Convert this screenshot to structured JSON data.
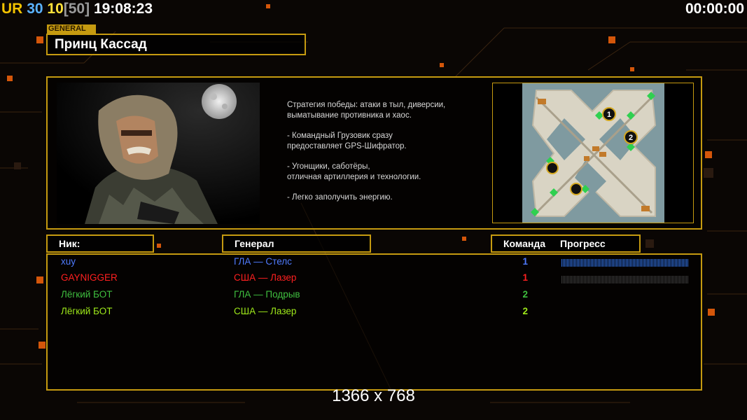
{
  "hud": {
    "ur": "UR",
    "val_a": "30",
    "val_b": "10",
    "val_c": "[50]",
    "clock": "19:08:23",
    "timer": "00:00:00"
  },
  "general": {
    "tag": "GENERAL",
    "name": "Принц Кассад"
  },
  "description": [
    "Стратегия победы: атаки в тыл, диверсии,\n выматывание противника и хаос.",
    "- Командный Грузовик сразу\nпредоставляет GPS-Шифратор.",
    "- Угонщики, саботёры,\nотличная артиллерия и технологии.",
    "- Легко заполучить энергию."
  ],
  "table": {
    "headers": {
      "nick": "Ник:",
      "general": "Генерал",
      "team": "Команда",
      "progress": "Прогресс"
    },
    "rows": [
      {
        "nick": "xuy",
        "general": "ГЛА — Стелс",
        "team": "1",
        "color": "#4f7bff",
        "progress": 1.0
      },
      {
        "nick": "GAYNIGGER",
        "general": "США — Лазер",
        "team": "1",
        "color": "#ff2020",
        "progress": 0.0
      },
      {
        "nick": "Лёгкий БОТ",
        "general": "ГЛА — Подрыв",
        "team": "2",
        "color": "#3fbf3f",
        "progress": null
      },
      {
        "nick": "Лёгкий БОТ",
        "general": "США — Лазер",
        "team": "2",
        "color": "#9ee81a",
        "progress": null
      }
    ]
  },
  "resolution": "1366 x 768",
  "accent": "#c59a10",
  "map_markers": [
    "1",
    "2"
  ]
}
